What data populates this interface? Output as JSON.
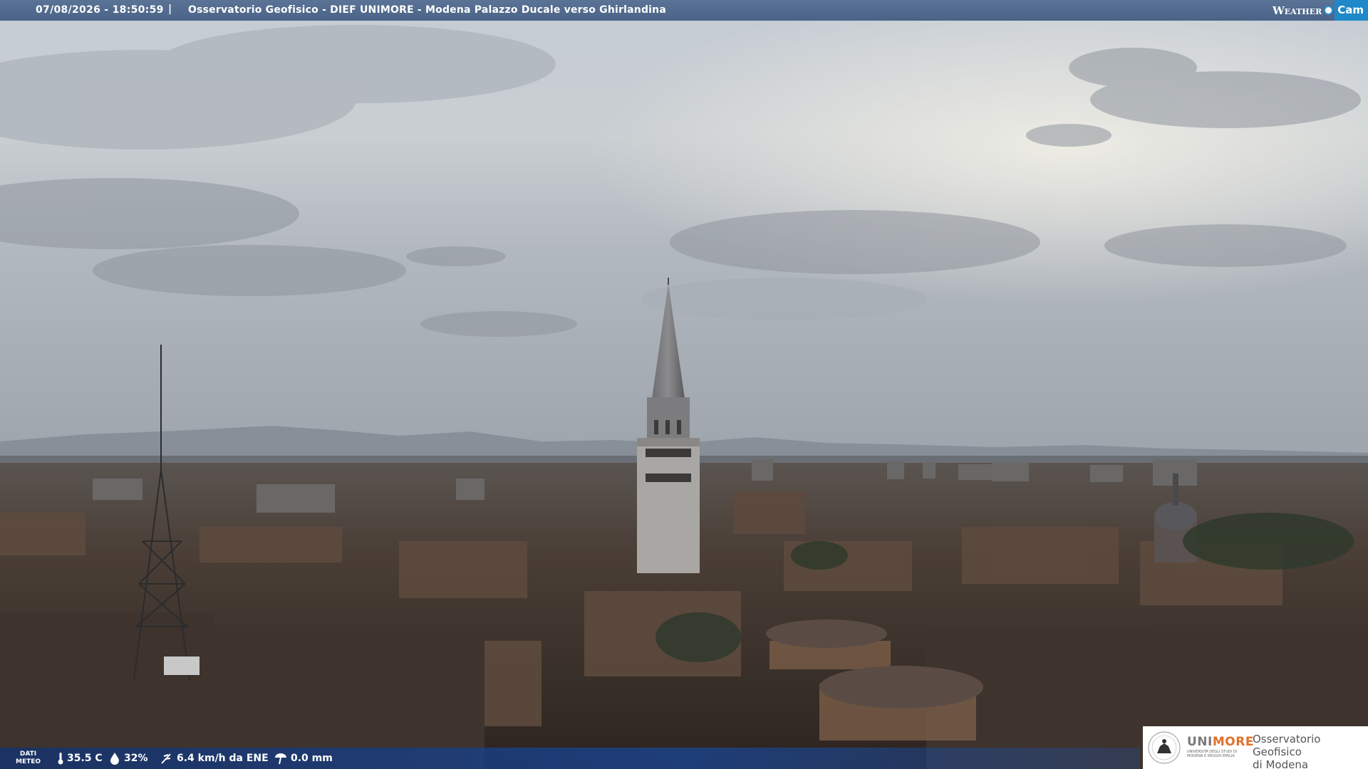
{
  "banner": {
    "timestamp": "07/08/2026 - 18:50:59",
    "separator": "|",
    "caption": "Osservatorio Geofisico - DIEF UNIMORE - Modena Palazzo Ducale verso Ghirlandina"
  },
  "brand": {
    "weather": "Weather",
    "cam": "Cam"
  },
  "weather": {
    "label_line1": "DATI",
    "label_line2": "METEO",
    "temperature": "35.5 C",
    "humidity": "32%",
    "wind": "6.4 km/h da ENE",
    "rain": "0.0 mm",
    "icons": [
      "thermometer-icon",
      "humidity-drop-icon",
      "wind-icon",
      "rain-gauge-icon"
    ]
  },
  "logo": {
    "uni_part1": "UNI",
    "uni_part2": "MORE",
    "uni_sub": "UNIVERSITÀ DEGLI STUDI DI MODENA E REGGIO EMILIA",
    "obs_line1": "Osservatorio Geofisico",
    "obs_line2": "di Modena"
  },
  "colors": {
    "banner": "#4f6a8e",
    "brand_cam": "#1e88c8",
    "unimore_orange": "#e0712a",
    "weather_bar": "#19408c"
  }
}
